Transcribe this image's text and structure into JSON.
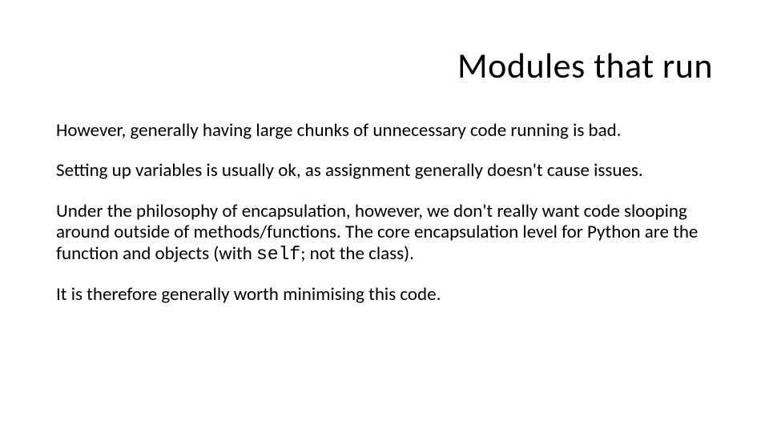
{
  "title": "Modules that run",
  "paragraphs": {
    "p1": "However, generally having large chunks of unnecessary code running is bad.",
    "p2": "Setting up variables is usually ok, as assignment generally doesn't cause issues.",
    "p3_before": "Under the philosophy of encapsulation, however, we don't really want code slooping around outside of methods/functions. The core encapsulation level for Python are the function and objects (with ",
    "p3_code": "self",
    "p3_after": "; not the class).",
    "p4": "It is therefore generally worth minimising this code."
  }
}
